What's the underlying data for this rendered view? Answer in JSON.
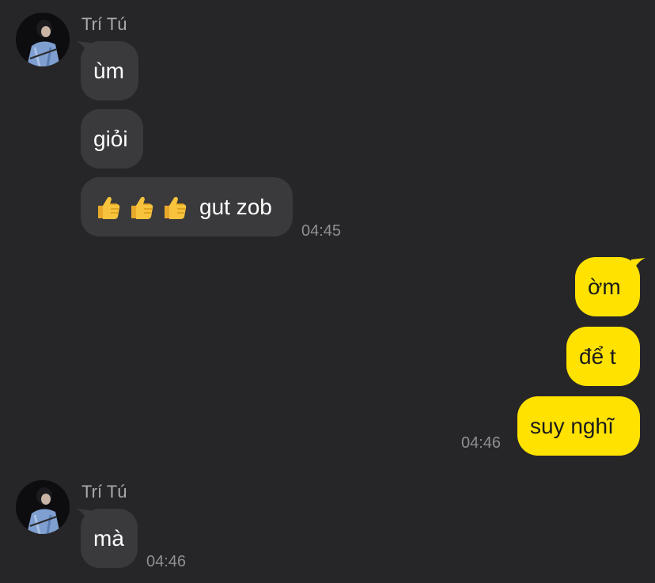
{
  "colors": {
    "background": "#262628",
    "incoming_bubble": "#3a3a3c",
    "outgoing_bubble": "#ffe200",
    "timestamp": "#8e8e93",
    "sender_name": "#a9a9ae"
  },
  "groups": [
    {
      "sender": "Trí Tú",
      "messages": [
        "ùm",
        "giỏi",
        "gut zob"
      ],
      "emoji_icon": "thumbs-up-icon",
      "time": "04:45"
    },
    {
      "sender": "",
      "messages": [
        "ờm",
        "để t",
        "suy nghĩ"
      ],
      "time": "04:46"
    },
    {
      "sender": "Trí Tú",
      "messages": [
        "mà"
      ],
      "time": "04:46"
    }
  ]
}
